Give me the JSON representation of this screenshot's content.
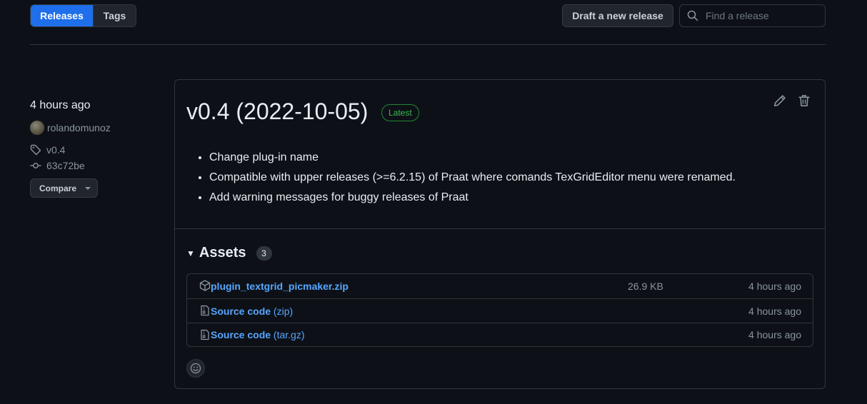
{
  "nav": {
    "tabs": [
      {
        "label": "Releases",
        "active": true
      },
      {
        "label": "Tags",
        "active": false
      }
    ],
    "draft_button": "Draft a new release",
    "search_placeholder": "Find a release"
  },
  "sidebar": {
    "time_ago": "4 hours ago",
    "author": "rolandomunoz",
    "tag": "v0.4",
    "commit": "63c72be",
    "compare_label": "Compare"
  },
  "release": {
    "title": "v0.4 (2022-10-05)",
    "badge": "Latest",
    "notes": [
      "Change plug-in name",
      "Compatible with upper releases (>=6.2.15) of Praat where comands TexGridEditor menu were renamed.",
      "Add warning messages for buggy releases of Praat"
    ],
    "assets_heading": "Assets",
    "assets_count": "3",
    "assets": [
      {
        "name": "plugin_textgrid_picmaker.zip",
        "suffix": "",
        "size": "26.9 KB",
        "time": "4 hours ago",
        "icon": "package-icon"
      },
      {
        "name": "Source code",
        "suffix": "(zip)",
        "size": "",
        "time": "4 hours ago",
        "icon": "file-zip-icon"
      },
      {
        "name": "Source code",
        "suffix": "(tar.gz)",
        "size": "",
        "time": "4 hours ago",
        "icon": "file-zip-icon"
      }
    ]
  },
  "colors": {
    "background": "#0d1117",
    "accent": "#1f6feb",
    "link": "#58a6ff",
    "latest_badge": "#3fb950",
    "border": "#30363d"
  }
}
